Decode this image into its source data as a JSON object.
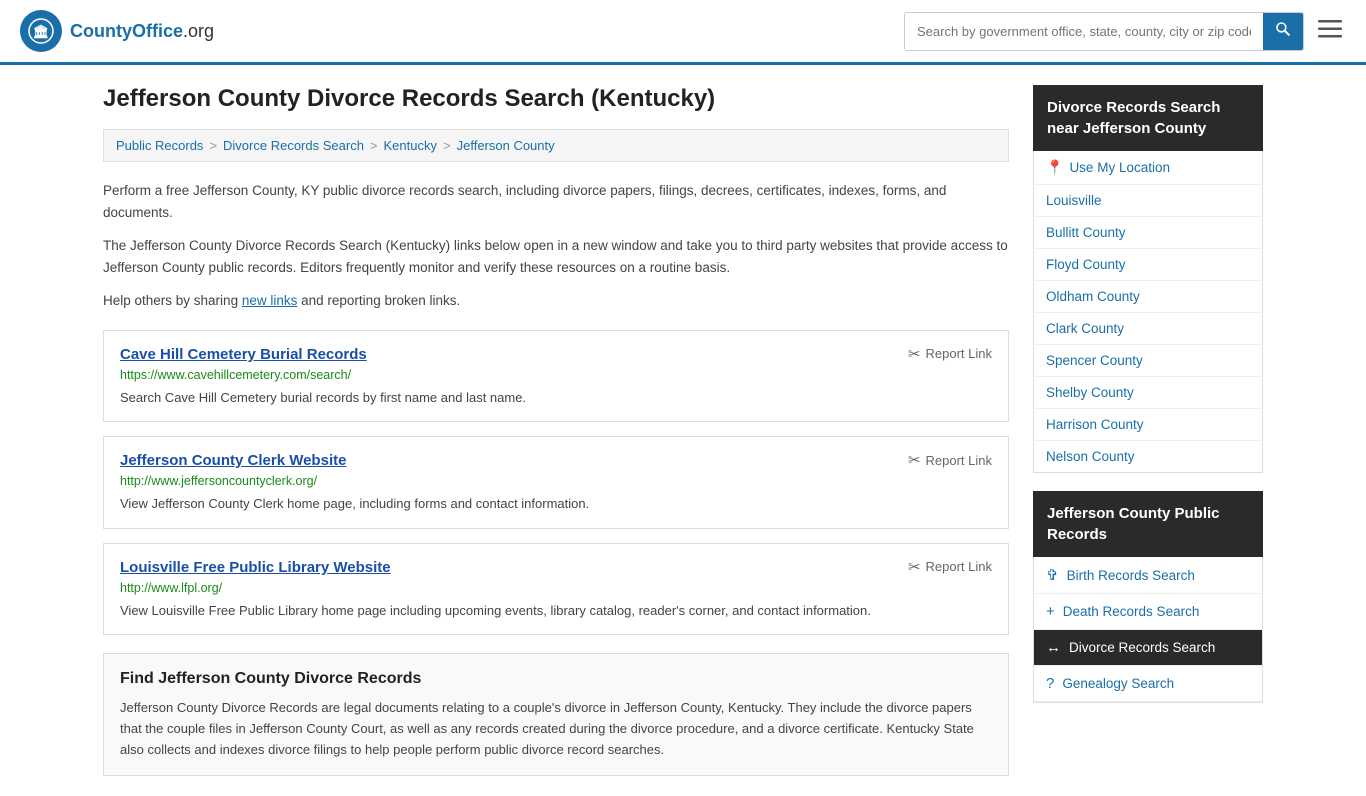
{
  "header": {
    "logo_text": "CountyOffice",
    "logo_suffix": ".org",
    "search_placeholder": "Search by government office, state, county, city or zip code"
  },
  "page": {
    "title": "Jefferson County Divorce Records Search (Kentucky)",
    "breadcrumb": [
      {
        "label": "Public Records",
        "href": "#"
      },
      {
        "label": "Divorce Records Search",
        "href": "#"
      },
      {
        "label": "Kentucky",
        "href": "#"
      },
      {
        "label": "Jefferson County",
        "href": "#"
      }
    ],
    "description1": "Perform a free Jefferson County, KY public divorce records search, including divorce papers, filings, decrees, certificates, indexes, forms, and documents.",
    "description2": "The Jefferson County Divorce Records Search (Kentucky) links below open in a new window and take you to third party websites that provide access to Jefferson County public records. Editors frequently monitor and verify these resources on a routine basis.",
    "description3": "Help others by sharing",
    "new_links_text": "new links",
    "description3b": "and reporting broken links."
  },
  "links": [
    {
      "title": "Cave Hill Cemetery Burial Records",
      "url": "https://www.cavehillcemetery.com/search/",
      "description": "Search Cave Hill Cemetery burial records by first name and last name."
    },
    {
      "title": "Jefferson County Clerk Website",
      "url": "http://www.jeffersoncountyclerk.org/",
      "description": "View Jefferson County Clerk home page, including forms and contact information."
    },
    {
      "title": "Louisville Free Public Library Website",
      "url": "http://www.lfpl.org/",
      "description": "View Louisville Free Public Library home page including upcoming events, library catalog, reader's corner, and contact information."
    }
  ],
  "report_label": "Report Link",
  "find_section": {
    "title": "Find Jefferson County Divorce Records",
    "body": "Jefferson County Divorce Records are legal documents relating to a couple's divorce in Jefferson County, Kentucky. They include the divorce papers that the couple files in Jefferson County Court, as well as any records created during the divorce procedure, and a divorce certificate. Kentucky State also collects and indexes divorce filings to help people perform public divorce record searches."
  },
  "sidebar": {
    "nearby_title": "Divorce Records Search near Jefferson County",
    "nearby_items": [
      {
        "label": "Use My Location",
        "is_location": true
      },
      {
        "label": "Louisville"
      },
      {
        "label": "Bullitt County"
      },
      {
        "label": "Floyd County"
      },
      {
        "label": "Oldham County"
      },
      {
        "label": "Clark County"
      },
      {
        "label": "Spencer County"
      },
      {
        "label": "Shelby County"
      },
      {
        "label": "Harrison County"
      },
      {
        "label": "Nelson County"
      }
    ],
    "public_records_title": "Jefferson County Public Records",
    "public_records_items": [
      {
        "label": "Birth Records Search",
        "icon": "✞",
        "active": false
      },
      {
        "label": "Death Records Search",
        "icon": "+",
        "active": false
      },
      {
        "label": "Divorce Records Search",
        "icon": "↔",
        "active": true
      },
      {
        "label": "Genealogy Search",
        "icon": "?",
        "active": false
      }
    ]
  }
}
